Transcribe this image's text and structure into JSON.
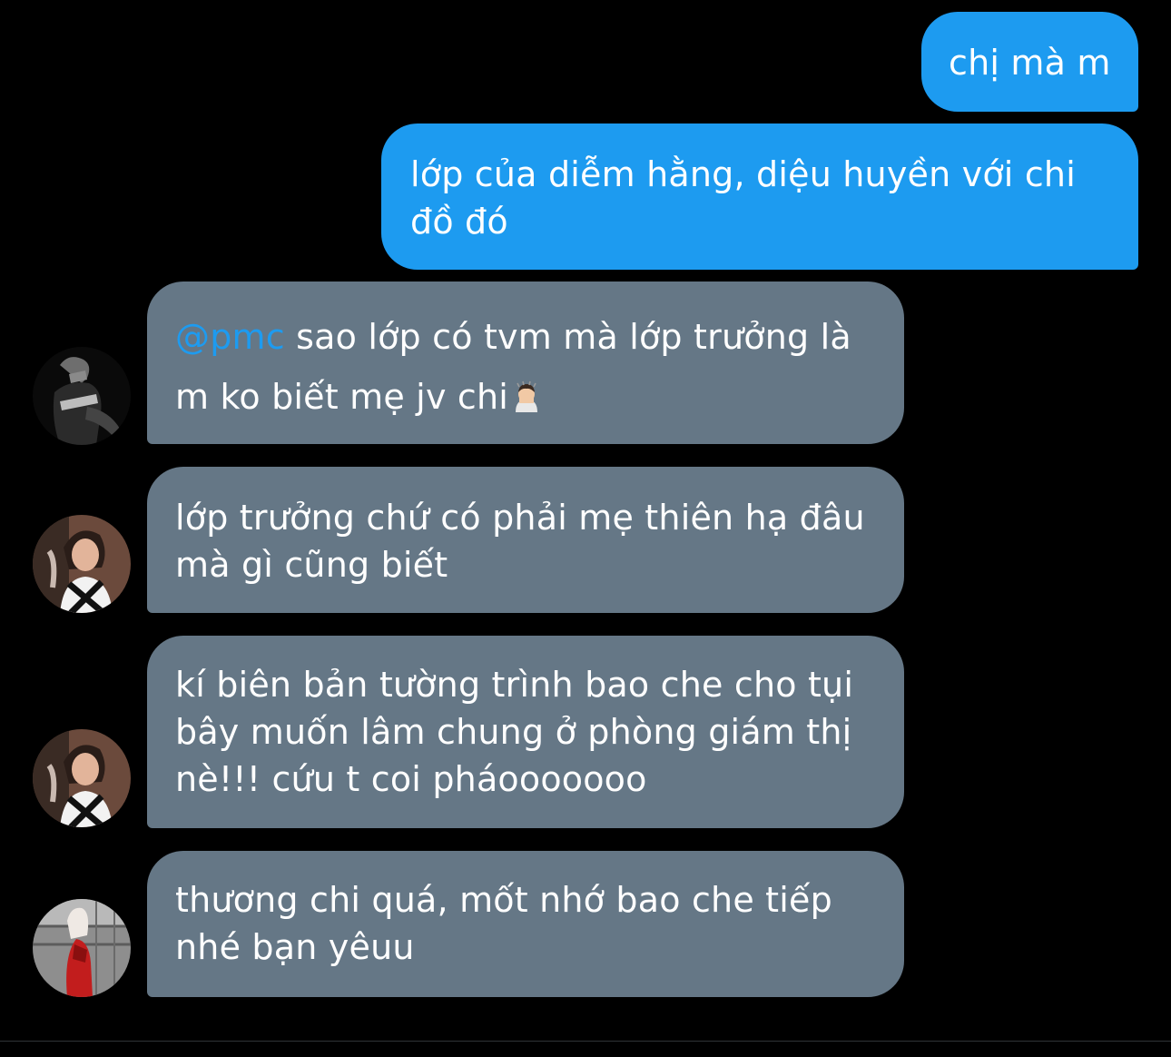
{
  "colors": {
    "background": "#000000",
    "outgoing_bubble": "#1d9bf0",
    "incoming_bubble": "#657786",
    "mention": "#1d9bf0",
    "text": "#ffffff"
  },
  "messages": [
    {
      "direction": "outgoing",
      "text": "chị mà m"
    },
    {
      "direction": "outgoing",
      "text": "lớp của diễm hằng, diệu huyền với chi đồ đó"
    },
    {
      "direction": "incoming",
      "mention": "@pmc",
      "line1": " sao lớp có tvm mà lớp trưởng là",
      "line2": "m ko biết mẹ jv chi",
      "emoji": "person-facepalm-emoji",
      "avatar": "avatar-1"
    },
    {
      "direction": "incoming",
      "text": "lớp trưởng chứ có phải mẹ thiên hạ đâu mà gì cũng biết",
      "avatar": "avatar-2"
    },
    {
      "direction": "incoming",
      "text": "kí biên bản tường trình bao che cho tụi bây muốn lâm chung ở phòng giám thị nè!!! cứu t coi pháooooooo",
      "avatar": "avatar-2"
    },
    {
      "direction": "incoming",
      "text": "thương chi quá, mốt nhớ bao che tiếp nhé bạn yêuu",
      "avatar": "avatar-3"
    }
  ]
}
